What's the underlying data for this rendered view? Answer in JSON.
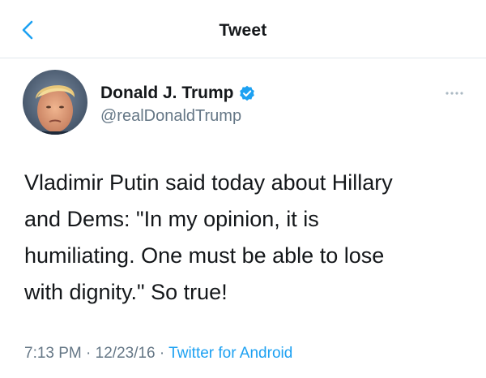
{
  "header": {
    "title": "Tweet",
    "back_icon": "chevron-left-icon"
  },
  "tweet": {
    "author": {
      "name": "Donald J. Trump",
      "handle": "@realDonaldTrump",
      "verified": true,
      "verified_icon": "verified-badge-icon"
    },
    "more_icon": "more-dots-icon",
    "text": "Vladimir Putin said today about Hillary\nand Dems: \"In my opinion, it is\nhumiliating. One must be able to lose\nwith dignity.\"  So true!",
    "time": "7:13 PM",
    "date": "12/23/16",
    "separator": " · ",
    "source": "Twitter for Android"
  },
  "colors": {
    "accent": "#1da1f2",
    "text_primary": "#14171a",
    "text_secondary": "#657786",
    "divider": "#e1e8ed"
  }
}
